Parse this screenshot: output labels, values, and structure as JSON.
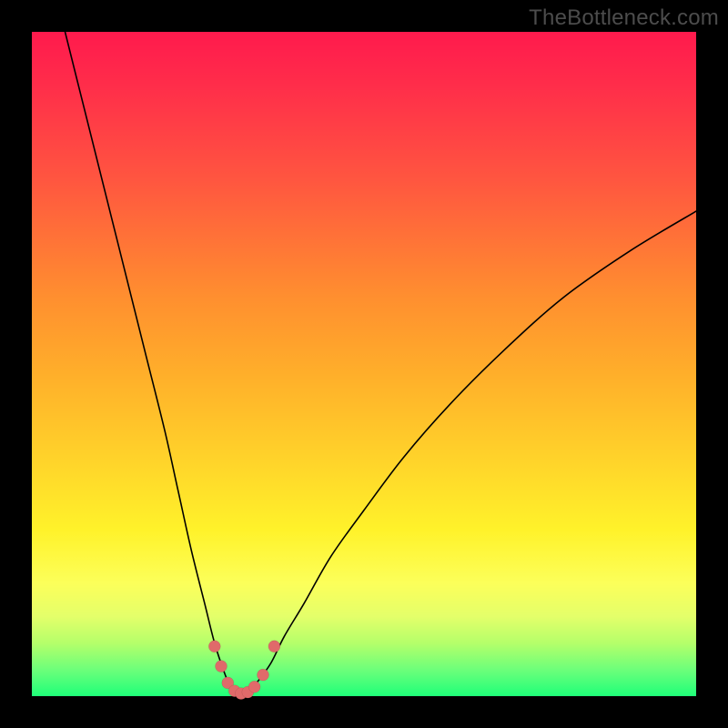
{
  "watermark": "TheBottleneck.com",
  "colors": {
    "background": "#000000",
    "gradient_top": "#ff1a4d",
    "gradient_bottom": "#1fff79",
    "curve": "#000000",
    "dots": "#e06a6a"
  },
  "chart_data": {
    "type": "line",
    "title": "",
    "xlabel": "",
    "ylabel": "",
    "xlim": [
      0,
      100
    ],
    "ylim": [
      0,
      100
    ],
    "grid": false,
    "legend": false,
    "series": [
      {
        "name": "bottleneck-curve",
        "x": [
          5,
          8,
          11,
          14,
          17,
          20,
          22,
          24,
          26,
          27.5,
          29,
          30,
          31,
          32,
          33,
          34,
          36,
          38,
          41,
          45,
          50,
          56,
          63,
          71,
          80,
          90,
          100
        ],
        "y": [
          100,
          88,
          76,
          64,
          52,
          40,
          31,
          22,
          14,
          8,
          3.5,
          1.2,
          0.4,
          0.4,
          1.0,
          2.2,
          5,
          9,
          14,
          21,
          28,
          36,
          44,
          52,
          60,
          67,
          73
        ]
      }
    ],
    "markers": [
      {
        "x": 27.5,
        "y": 7.5
      },
      {
        "x": 28.5,
        "y": 4.5
      },
      {
        "x": 29.5,
        "y": 2.0
      },
      {
        "x": 30.5,
        "y": 0.8
      },
      {
        "x": 31.5,
        "y": 0.4
      },
      {
        "x": 32.5,
        "y": 0.6
      },
      {
        "x": 33.5,
        "y": 1.4
      },
      {
        "x": 34.8,
        "y": 3.2
      },
      {
        "x": 36.5,
        "y": 7.5
      }
    ],
    "annotations": []
  }
}
